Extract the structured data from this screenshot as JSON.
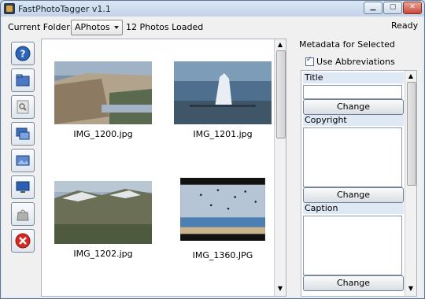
{
  "window": {
    "title": "FastPhotoTagger v1.1"
  },
  "topbar": {
    "current_folder_label": "Current Folder:",
    "folder_value": "APhotos",
    "photos_loaded": "12 Photos Loaded",
    "status": "Ready"
  },
  "toolbar": {
    "buttons": [
      {
        "name": "help-icon"
      },
      {
        "name": "open-folder-icon"
      },
      {
        "name": "zoom-icon"
      },
      {
        "name": "slideshow-icon"
      },
      {
        "name": "picture-icon"
      },
      {
        "name": "monitor-icon"
      },
      {
        "name": "bag-icon"
      },
      {
        "name": "close-icon"
      }
    ]
  },
  "gallery": {
    "photos": [
      {
        "filename": "IMG_1200.jpg"
      },
      {
        "filename": "IMG_1201.jpg"
      },
      {
        "filename": "IMG_1202.jpg"
      },
      {
        "filename": "IMG_1360.JPG"
      }
    ]
  },
  "metadata": {
    "heading": "Metadata for Selected",
    "use_abbreviations_label": "Use Abbreviations",
    "use_abbreviations_checked": true,
    "fields": [
      {
        "label": "Title",
        "button": "Change"
      },
      {
        "label": "Copyright",
        "button": "Change"
      },
      {
        "label": "Caption",
        "button": "Change"
      }
    ]
  }
}
